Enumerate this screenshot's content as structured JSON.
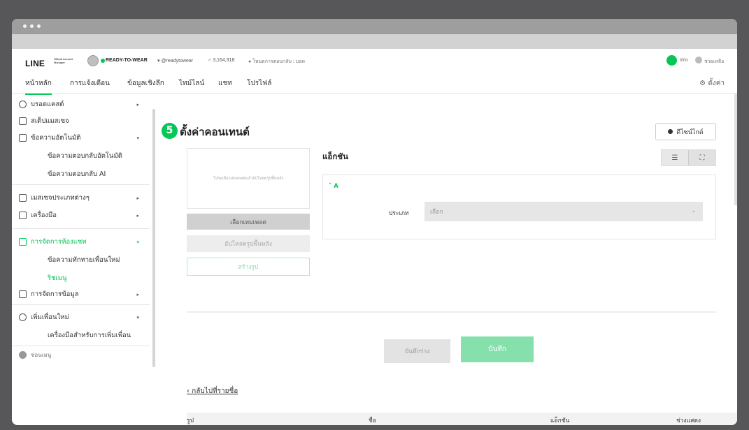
{
  "topbar": {
    "logo": "LINE",
    "logo_sub": "Official Account Manager",
    "account_name": "READY-TO-WEAR",
    "account_id": "▾ @readytowear",
    "followers": "♂ 3,164,318",
    "status": "● โหมดการตอบกลับ : บอท",
    "user_name": "Win",
    "help_label": "ช่วยเหลือ"
  },
  "nav": {
    "tabs": [
      "หน้าหลัก",
      "การแจ้งเตือน",
      "ข้อมูลเชิงลึก",
      "ไทม์ไลน์",
      "แชท",
      "โปรไฟล์"
    ],
    "settings": "⚙ ตั้งค่า"
  },
  "sidebar": {
    "items": [
      "บรอดแคสต์",
      "สเต็ปแมสเซจ",
      "ข้อความอัตโนมัติ",
      "เมสเซจประเภทต่างๆ",
      "เครื่องมือ",
      "การจัดการห้องแชท",
      "การจัดการข้อมูล",
      "เพิ่มเพื่อนใหม่",
      "ซ่อนเมนู"
    ],
    "subs": [
      "ข้อความตอบกลับอัตโนมัติ",
      "ข้อความตอบกลับ AI",
      "ข้อความทักทายเพื่อนใหม่",
      "ริชเมนู",
      "เครื่องมือสำหรับการเพิ่มเพื่อน"
    ]
  },
  "main": {
    "step": "5",
    "title": "ตั้งค่าคอนเทนต์",
    "design_guide": "ดีไซน์ไกด์",
    "preview_hint": "โปรดเลือกเทมเพลตแล้วอัปโหลดรูปพื้นหลัง",
    "select_template": "เลือกเทมเพลต",
    "upload_background": "อัปโหลดรูปพื้นหลัง",
    "create_image": "สร้างรูป",
    "action_title": "แอ็กชัน",
    "action_a": "˅ A",
    "type_label": "ประเภท",
    "type_placeholder": "เลือก",
    "save_draft": "บันทึกร่าง",
    "save": "บันทึก",
    "back": "‹  กลับไปที่รายชื่อ",
    "table_headers": [
      "รูป",
      "ชื่อ",
      "แอ็กชัน",
      "ช่วงแสดง"
    ]
  },
  "colors": {
    "brand": "#06c755",
    "save_button": "#86e0ac"
  }
}
